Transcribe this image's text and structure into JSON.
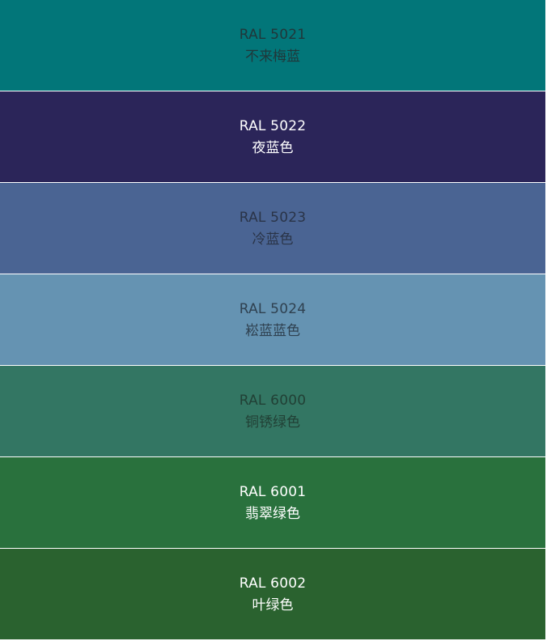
{
  "swatches": [
    {
      "code": "RAL 5021",
      "name": "不来梅蓝",
      "color": "#027679",
      "text_color": "#20373a"
    },
    {
      "code": "RAL 5022",
      "name": "夜蓝色",
      "color": "#2b2559",
      "text_color": "#ffffff"
    },
    {
      "code": "RAL 5023",
      "name": "冷蓝色",
      "color": "#4a6493",
      "text_color": "#2a3448"
    },
    {
      "code": "RAL 5024",
      "name": "崧蓝蓝色",
      "color": "#6593b2",
      "text_color": "#2f4150"
    },
    {
      "code": "RAL 6000",
      "name": "铜锈绿色",
      "color": "#337663",
      "text_color": "#214035"
    },
    {
      "code": "RAL 6001",
      "name": "翡翠绿色",
      "color": "#29713d",
      "text_color": "#ffffff"
    },
    {
      "code": "RAL 6002",
      "name": "叶绿色",
      "color": "#2a622f",
      "text_color": "#ffffff"
    }
  ]
}
